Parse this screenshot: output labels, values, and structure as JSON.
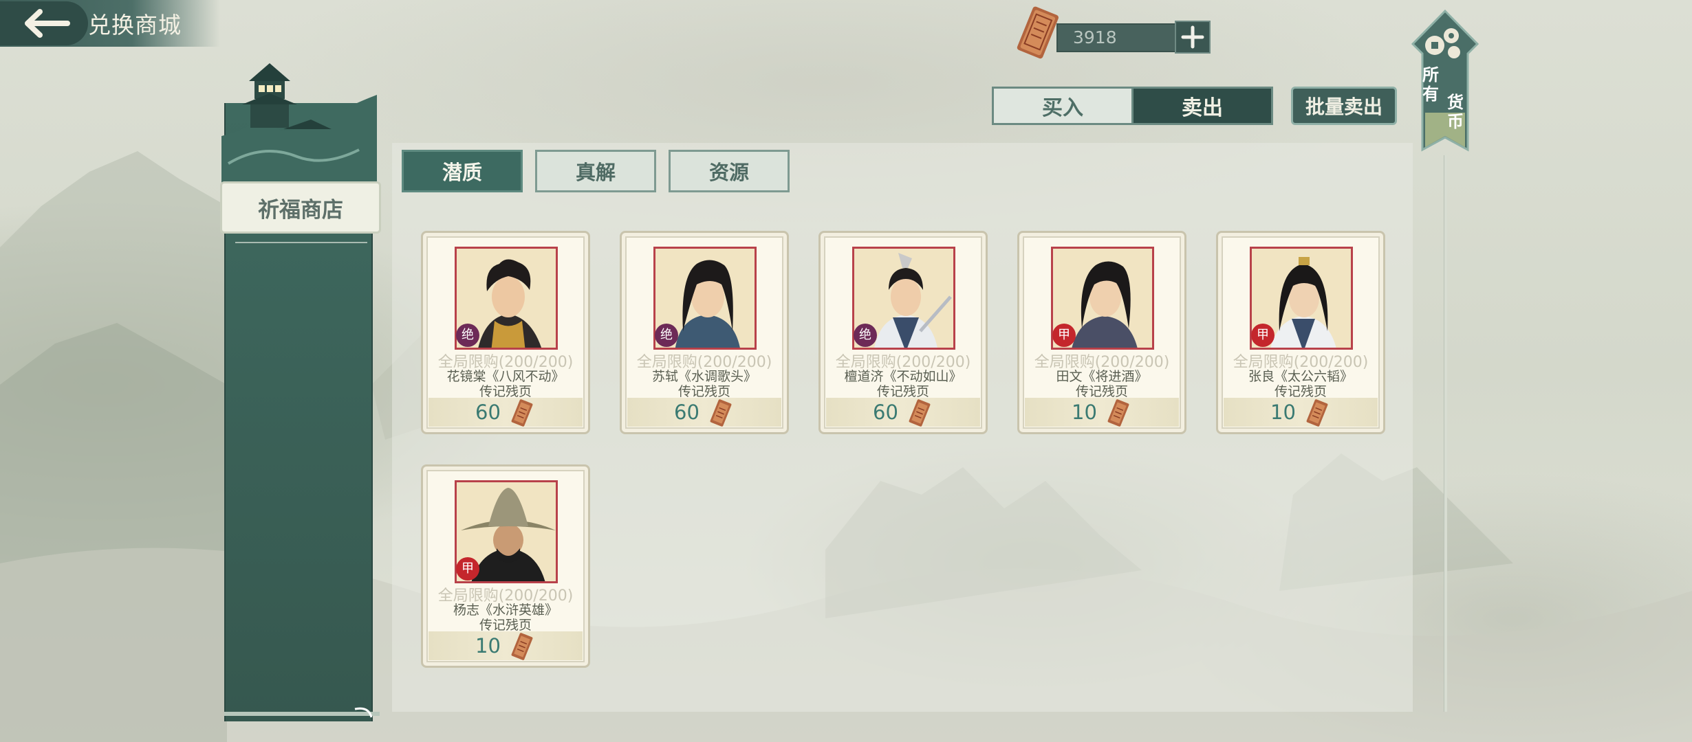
{
  "header": {
    "title": "兑换商城"
  },
  "currency": {
    "amount": "3918",
    "add_label": "+"
  },
  "trade": {
    "buy_label": "买入",
    "sell_label": "卖出",
    "batch_sell_label": "批量卖出"
  },
  "banner": {
    "chars": [
      "所",
      "有",
      "货",
      "币"
    ]
  },
  "sidebar": {
    "shop_label": "祈福商店"
  },
  "tabs": [
    {
      "label": "潜质",
      "active": true
    },
    {
      "label": "真解",
      "active": false
    },
    {
      "label": "资源",
      "active": false
    }
  ],
  "items": [
    {
      "grade": "绝",
      "limit": "全局限购(200/200)",
      "name": "花镜棠《八风不动》",
      "type": "传记残页",
      "price": "60"
    },
    {
      "grade": "绝",
      "limit": "全局限购(200/200)",
      "name": "苏轼《水调歌头》",
      "type": "传记残页",
      "price": "60"
    },
    {
      "grade": "绝",
      "limit": "全局限购(200/200)",
      "name": "檀道济《不动如山》",
      "type": "传记残页",
      "price": "60"
    },
    {
      "grade": "甲",
      "limit": "全局限购(200/200)",
      "name": "田文《将进酒》",
      "type": "传记残页",
      "price": "10"
    },
    {
      "grade": "甲",
      "limit": "全局限购(200/200)",
      "name": "张良《太公六韬》",
      "type": "传记残页",
      "price": "10"
    },
    {
      "grade": "甲",
      "limit": "全局限购(200/200)",
      "name": "杨志《水浒英雄》",
      "type": "传记残页",
      "price": "10"
    }
  ]
}
